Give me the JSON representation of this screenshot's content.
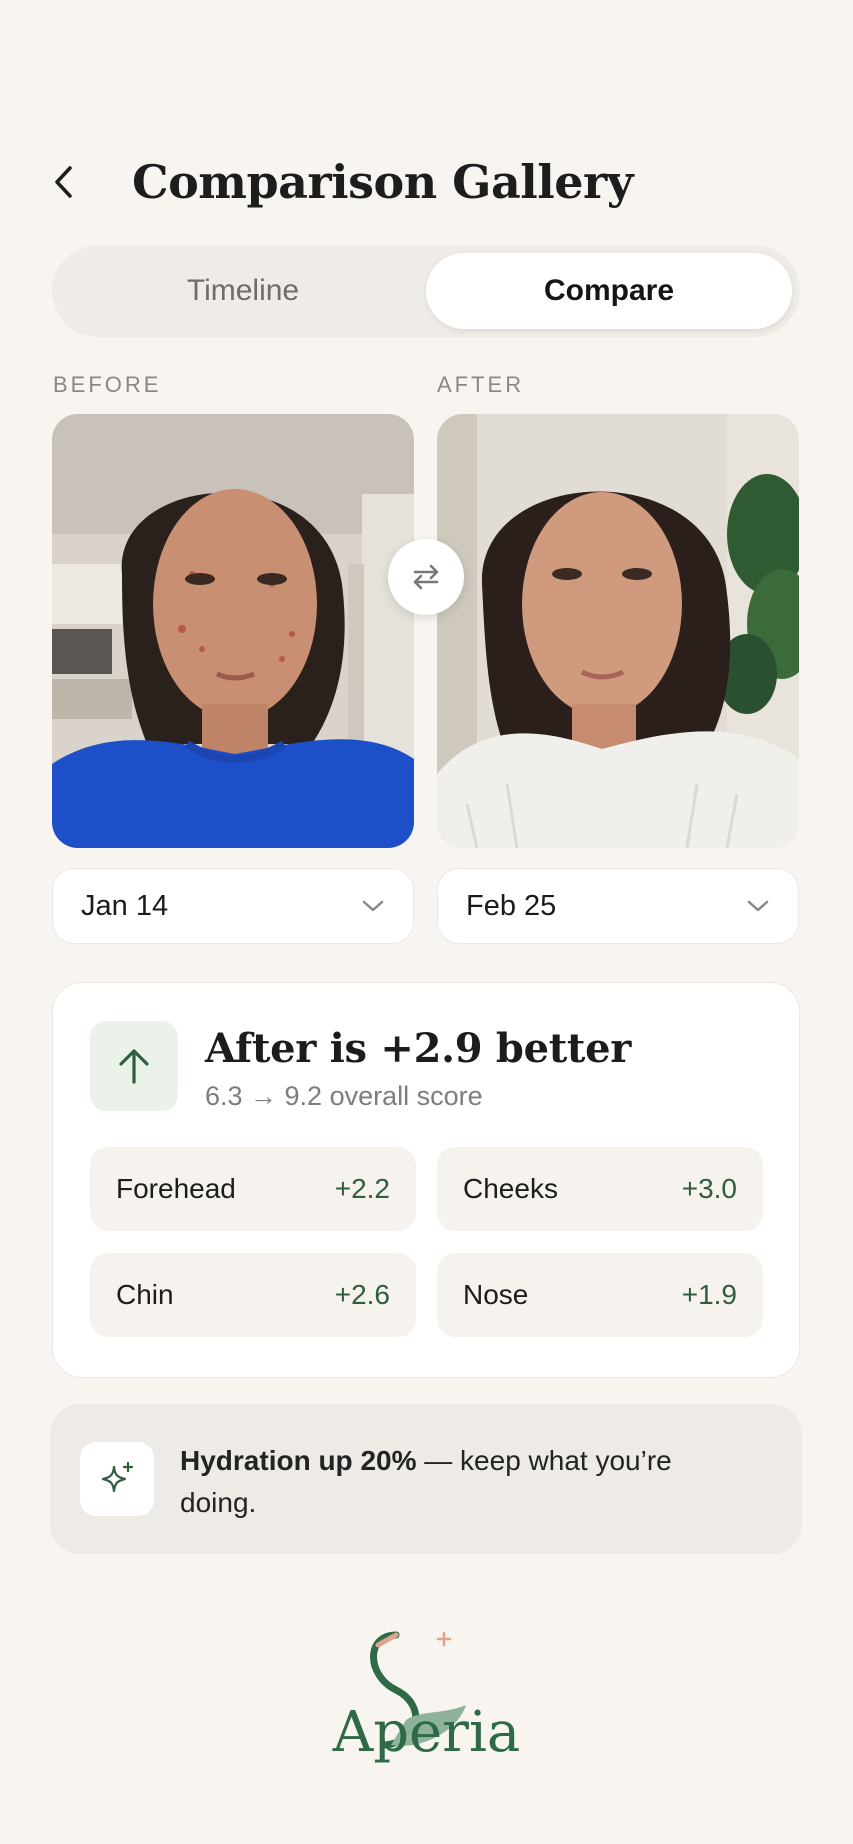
{
  "header": {
    "title": "Comparison Gallery",
    "back_icon": "chevron-left-icon"
  },
  "tabs": [
    {
      "label": "Timeline",
      "active": false
    },
    {
      "label": "Compare",
      "active": true
    }
  ],
  "before": {
    "label": "BEFORE",
    "date": "Jan 14"
  },
  "after": {
    "label": "AFTER",
    "date": "Feb 25"
  },
  "swap_icon": "swap-arrows-icon",
  "score": {
    "headline": "After is +2.9 better",
    "subtext": "6.3 → 9.2 overall score",
    "icon": "arrow-up-icon",
    "regions": [
      {
        "name": "Forehead",
        "delta": "+2.2"
      },
      {
        "name": "Cheeks",
        "delta": "+3.0"
      },
      {
        "name": "Chin",
        "delta": "+2.6"
      },
      {
        "name": "Nose",
        "delta": "+1.9"
      }
    ]
  },
  "tip": {
    "icon": "sparkle-icon",
    "bold": "Hydration up 20%",
    "rest": " — keep what you’re doing."
  },
  "brand": {
    "name": "Aperia"
  },
  "colors": {
    "background": "#f8f5f1",
    "accent_green": "#2f5e3e",
    "brand_green": "#2f6a46",
    "card": "#ffffff"
  }
}
